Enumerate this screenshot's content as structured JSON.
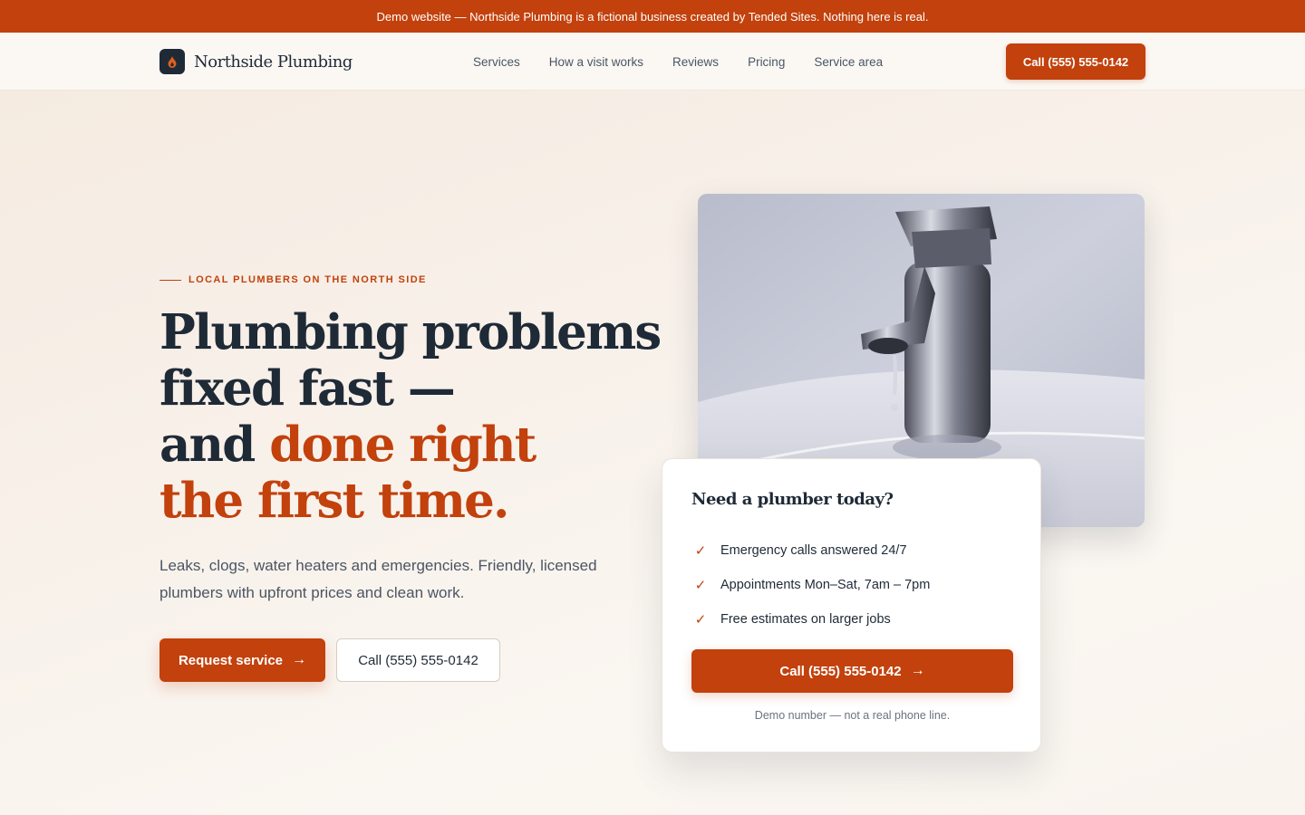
{
  "banner": {
    "text": "Demo website — Northside Plumbing is a fictional business created by Tended Sites. Nothing here is real."
  },
  "nav": {
    "brand": "Northside Plumbing",
    "logo_icon": "flame-drop-icon",
    "links": [
      "Services",
      "How a visit works",
      "Reviews",
      "Pricing",
      "Service area"
    ],
    "cta": "Call (555) 555-0142"
  },
  "hero": {
    "eyebrow": "LOCAL PLUMBERS ON THE NORTH SIDE",
    "headline_line1": "Plumbing problems",
    "headline_line2": "fixed fast —",
    "headline_line3_plain": "and ",
    "headline_line3_accent": "done right",
    "headline_line4": "the first time.",
    "subtext": "Leaks, clogs, water heaters and emergencies. Friendly, licensed plumbers with upfront prices and clean work.",
    "primary_button": "Request service",
    "secondary_button": "Call (555) 555-0142"
  },
  "card": {
    "title": "Need a plumber today?",
    "items": [
      "Emergency calls answered 24/7",
      "Appointments Mon–Sat, 7am – 7pm",
      "Free estimates on larger jobs"
    ],
    "cta": "Call (555) 555-0142",
    "note": "Demo number — not a real phone line."
  },
  "colors": {
    "accent": "#c2410c",
    "ink": "#1f2a37",
    "muted": "#4b5563",
    "background": "#faf6f1"
  }
}
